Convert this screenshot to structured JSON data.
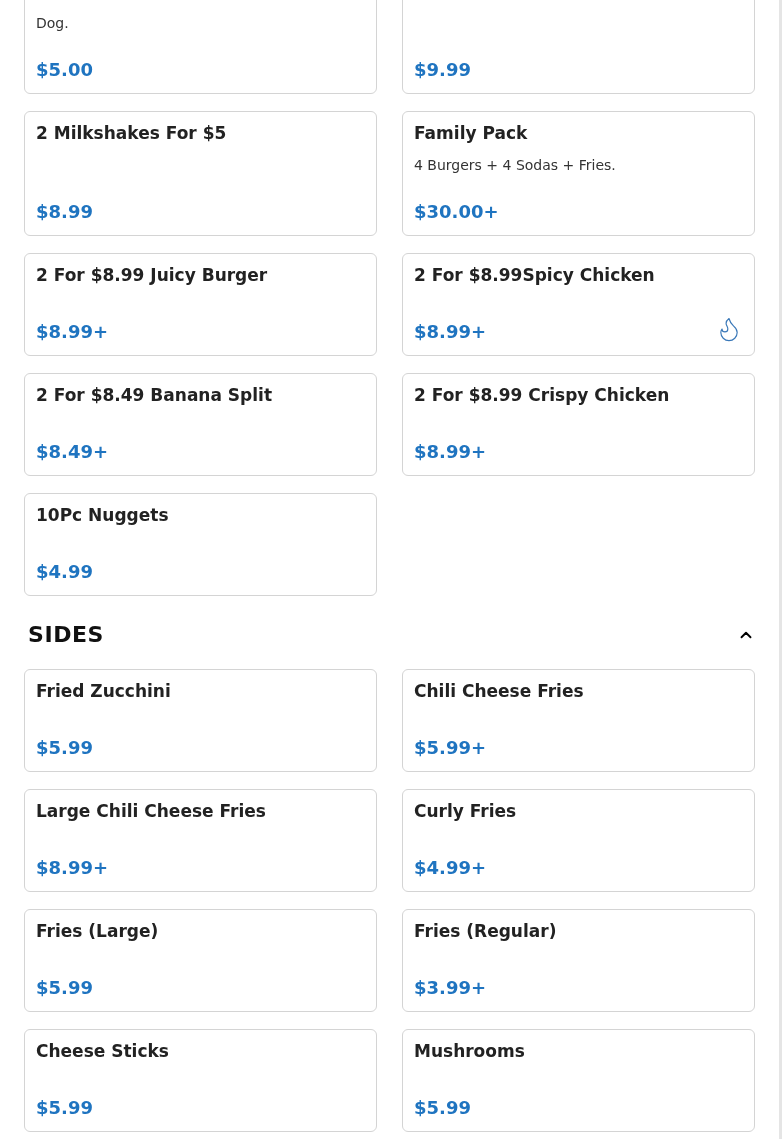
{
  "sections": [
    {
      "items": [
        {
          "description": "Dog.",
          "price": "$5.00",
          "spicy": false
        },
        {
          "price": "$9.99",
          "spicy": false
        },
        {
          "name": "2 Milkshakes For $5",
          "price": "$8.99",
          "spicy": false
        },
        {
          "name": "Family Pack",
          "description": "4 Burgers + 4 Sodas + Fries.",
          "price": "$30.00+",
          "spicy": false
        },
        {
          "name": "2 For $8.99 Juicy Burger",
          "price": "$8.99+",
          "spicy": false
        },
        {
          "name": "2 For $8.99Spicy Chicken",
          "price": "$8.99+",
          "spicy": true
        },
        {
          "name": "2 For $8.49 Banana Split",
          "price": "$8.49+",
          "spicy": false
        },
        {
          "name": "2 For $8.99 Crispy Chicken",
          "price": "$8.99+",
          "spicy": false
        },
        {
          "name": "10Pc Nuggets",
          "price": "$4.99",
          "spicy": false
        }
      ]
    },
    {
      "title": "SIDES",
      "expanded": true,
      "items": [
        {
          "name": "Fried Zucchini",
          "price": "$5.99",
          "spicy": false
        },
        {
          "name": "Chili Cheese Fries",
          "price": "$5.99+",
          "spicy": false
        },
        {
          "name": "Large Chili Cheese Fries",
          "price": "$8.99+",
          "spicy": false
        },
        {
          "name": "Curly Fries",
          "price": "$4.99+",
          "spicy": false
        },
        {
          "name": "Fries (Large)",
          "price": "$5.99",
          "spicy": false
        },
        {
          "name": "Fries (Regular)",
          "price": "$3.99+",
          "spicy": false
        },
        {
          "name": "Cheese Sticks",
          "price": "$5.99",
          "spicy": false
        },
        {
          "name": "Mushrooms",
          "price": "$5.99",
          "spicy": false
        }
      ]
    }
  ]
}
